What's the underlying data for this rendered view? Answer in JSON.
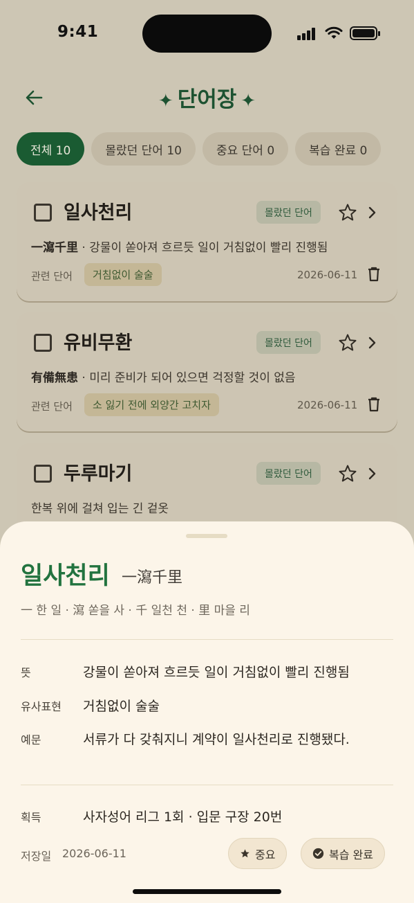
{
  "status": {
    "time": "9:41"
  },
  "header": {
    "title": "단어장",
    "spark": "✦"
  },
  "filters": [
    {
      "label": "전체 10",
      "active": true
    },
    {
      "label": "몰랐던 단어 10",
      "active": false
    },
    {
      "label": "중요 단어 0",
      "active": false
    },
    {
      "label": "복습 완료 0",
      "active": false
    }
  ],
  "cards": [
    {
      "word": "일사천리",
      "badge": "몰랐던 단어",
      "hanja": "一瀉千里",
      "definition": "· 강물이 쏟아져 흐르듯 일이 거침없이 빨리 진행됨",
      "related_label": "관련 단어",
      "related": "거침없이 술술",
      "date": "2026-06-11"
    },
    {
      "word": "유비무환",
      "badge": "몰랐던 단어",
      "hanja": "有備無患",
      "definition": "· 미리 준비가 되어 있으면 걱정할 것이 없음",
      "related_label": "관련 단어",
      "related": "소 잃기 전에 외양간 고치자",
      "date": "2026-06-11"
    },
    {
      "word": "두루마기",
      "badge": "몰랐던 단어",
      "definition": "한복 위에 걸쳐 입는 긴 겉옷"
    }
  ],
  "sheet": {
    "word": "일사천리",
    "hanja": "一瀉千里",
    "decomposition": "一 한 일 · 瀉 쏟을 사 · 千 일천 천 · 里 마을 리",
    "meaning_label": "뜻",
    "meaning": "강물이 쏟아져 흐르듯 일이 거침없이 빨리 진행됨",
    "similar_label": "유사표현",
    "similar": "거침없이 술술",
    "example_label": "예문",
    "example": "서류가 다 갖춰지니 계약이 일사천리로 진행됐다.",
    "acquired_label": "획득",
    "acquired": "사자성어 리그 1회 · 입문 구장 20번",
    "saved_label": "저장일",
    "saved_date": "2026-06-11",
    "important_btn": "중요",
    "reviewed_btn": "복습 완료"
  },
  "colors": {
    "accent": "#1a5b32",
    "sheet_bg": "#fcf5e9",
    "word_green": "#22733f"
  }
}
